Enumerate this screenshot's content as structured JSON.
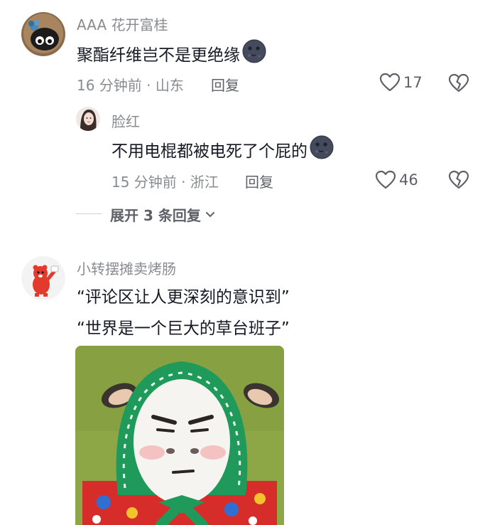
{
  "comments": [
    {
      "username": "AAA 花开富桂",
      "text": "聚酯纤维岂不是更绝缘",
      "time_location": "16 分钟前 · 山东",
      "reply_label": "回复",
      "likes": "17",
      "emoji": "dark-moon-face-emoji"
    },
    {
      "username": "脸红",
      "text": "不用电棍都被电死了个屁的",
      "time_location": "15 分钟前 · 浙江",
      "reply_label": "回复",
      "likes": "46",
      "emoji": "dark-moon-face-emoji"
    },
    {
      "username": "小转摆摊卖烤肠",
      "text_line1": "“评论区让人更深刻的意识到”",
      "text_line2": "“世界是一个巨大的草台班子”"
    }
  ],
  "expand_replies": "展开 3 条回复",
  "colors": {
    "text": "#161823",
    "meta": "#8a8b91",
    "background": "#ffffff"
  },
  "icons": [
    "heart-outline-icon",
    "broken-heart-icon",
    "chevron-down-icon"
  ]
}
